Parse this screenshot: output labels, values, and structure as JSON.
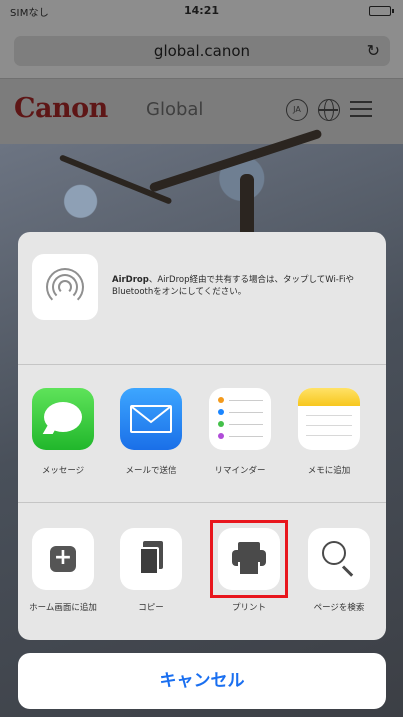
{
  "status_bar": {
    "carrier": "SIMなし",
    "time": "14:21"
  },
  "browser": {
    "url": "global.canon",
    "reload_icon": "reload-icon"
  },
  "site_header": {
    "logo_text": "Canon",
    "section": "Global",
    "lang_badge": "JA",
    "icons": [
      "globe-icon",
      "menu-icon"
    ]
  },
  "share_sheet": {
    "airdrop": {
      "icon": "airdrop-icon",
      "description_bold": "AirDrop",
      "description": "、AirDrop経由で共有する場合は、タップしてWi-FiやBluetoothをオンにしてください。"
    },
    "apps": [
      {
        "label": "メッセージ",
        "icon": "messages-icon"
      },
      {
        "label": "メールで送信",
        "icon": "mail-icon"
      },
      {
        "label": "リマインダー",
        "icon": "reminders-icon"
      },
      {
        "label": "メモに追加",
        "icon": "notes-icon"
      }
    ],
    "actions": [
      {
        "label": "ホーム画面に追加",
        "icon": "add-to-home-icon"
      },
      {
        "label": "コピー",
        "icon": "copy-icon"
      },
      {
        "label": "プリント",
        "icon": "print-icon",
        "highlighted": true
      },
      {
        "label": "ページを検索",
        "icon": "find-in-page-icon"
      }
    ],
    "cancel_label": "キャンセル"
  },
  "colors": {
    "highlight": "#e8161d",
    "cancel_text": "#1a6ff0",
    "canon_red": "#5e1616"
  }
}
